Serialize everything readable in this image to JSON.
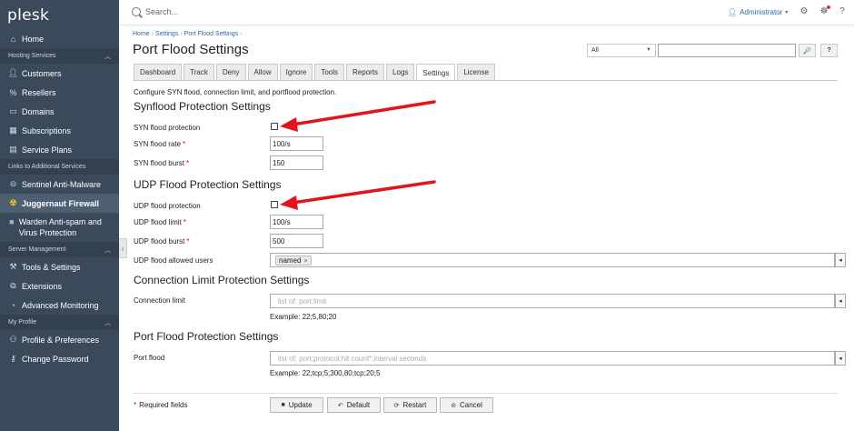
{
  "sidebar": {
    "logo": "plesk",
    "items_top": [
      {
        "label": "Home",
        "icon": "home-icon"
      }
    ],
    "sections": [
      {
        "title": "Hosting Services",
        "items": [
          {
            "label": "Customers",
            "icon": "user-icon"
          },
          {
            "label": "Resellers",
            "icon": "percent-icon"
          },
          {
            "label": "Domains",
            "icon": "monitor-icon"
          },
          {
            "label": "Subscriptions",
            "icon": "grid-icon"
          },
          {
            "label": "Service Plans",
            "icon": "document-icon"
          }
        ]
      },
      {
        "title": "Links to Additional Services",
        "items": [
          {
            "label": "Sentinel Anti-Malware",
            "icon": "shield-icon"
          },
          {
            "label": "Juggernaut Firewall",
            "icon": "firewall-icon"
          },
          {
            "label": "Warden Anti-spam and Virus Protection",
            "icon": "warden-icon"
          }
        ]
      },
      {
        "title": "Server Management",
        "items": [
          {
            "label": "Tools & Settings",
            "icon": "tools-icon"
          },
          {
            "label": "Extensions",
            "icon": "extensions-icon"
          },
          {
            "label": "Advanced Monitoring",
            "icon": "gauge-icon"
          }
        ]
      },
      {
        "title": "My Profile",
        "items": [
          {
            "label": "Profile & Preferences",
            "icon": "profile-icon"
          },
          {
            "label": "Change Password",
            "icon": "key-icon"
          }
        ]
      }
    ]
  },
  "topbar": {
    "search_placeholder": "Search...",
    "user": "Administrator"
  },
  "breadcrumb": [
    "Home",
    "Settings",
    "Port Flood Settings"
  ],
  "page_title": "Port Flood Settings",
  "filter": {
    "select_value": "All",
    "search_button": "🔎",
    "help_button": "?"
  },
  "tabs": [
    "Dashboard",
    "Track",
    "Deny",
    "Allow",
    "Ignore",
    "Tools",
    "Reports",
    "Logs",
    "Settings",
    "License"
  ],
  "active_tab": "Settings",
  "description": "Configure SYN flood, connection limit, and portflood protection.",
  "syn": {
    "title": "Synflood Protection Settings",
    "protection_label": "SYN flood protection",
    "rate_label": "SYN flood rate",
    "rate_value": "100/s",
    "burst_label": "SYN flood burst",
    "burst_value": "150"
  },
  "udp": {
    "title": "UDP Flood Protection Settings",
    "protection_label": "UDP flood protection",
    "limit_label": "UDP flood limit",
    "limit_value": "100/s",
    "burst_label": "UDP flood burst",
    "burst_value": "500",
    "allowed_label": "UDP flood allowed users",
    "allowed_tag": "named"
  },
  "conn": {
    "title": "Connection Limit Protection Settings",
    "label": "Connection limit",
    "placeholder": "list of: port;limit",
    "example": "Example: 22;5,80;20"
  },
  "portflood": {
    "title": "Port Flood Protection Settings",
    "label": "Port flood",
    "placeholder": "list of: port;protocol;hit count*;interval seconds",
    "example": "Example: 22;tcp;5;300,80;tcp;20;5"
  },
  "footer": {
    "required_note": "Required fields",
    "buttons": [
      "Update",
      "Default",
      "Restart",
      "Cancel"
    ]
  },
  "colors": {
    "sidebar": "#3b4a5a",
    "link": "#2c6aa0",
    "arrow": "#e0161c",
    "required": "#d0021b"
  }
}
